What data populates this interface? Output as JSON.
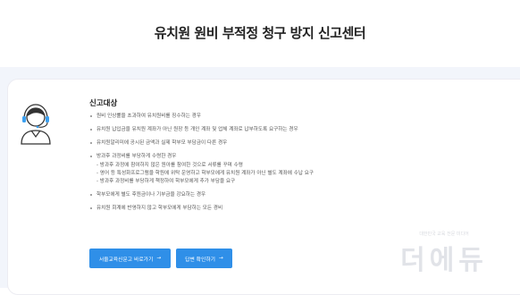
{
  "page": {
    "title": "유치원 원비 부적정 청구 방지 신고센터"
  },
  "report": {
    "section_title": "신고대상",
    "items": [
      "원비 인상률을 초과하여 유치원비를 징수하는 경우",
      "유치원 납입금을 유치원 계좌가 아닌 원장 등 개인 계좌 및 업체 계좌로 납부하도록 요구하는 경우",
      "유치원알리미에 공시된 금액과 실제 학부모 부담금이 다른 경우"
    ],
    "group": {
      "label": "방과후 과정비를 부당하게 수령한 경우",
      "sub_items": [
        "- 방과후 과정에 참여하지 않은 원아를 참여한 것으로 서류를 꾸며 수령",
        "- 영어 등 특성화프로그램을 학원에 위탁 운영하고 학부모에게 유치원 계좌가 아닌 별도 계좌에 수납 요구",
        "- 방과후 과정비를 부당하게 책정하여 학부모에게 추가 부담을 요구"
      ]
    },
    "items_after": [
      "학부모에게 별도 후원금이나 기부금을 강요하는 경우",
      "유치원 회계에 반영하지 않고 학부모에게 부담하는 모든 경비"
    ]
  },
  "buttons": {
    "seoul_report": "서울교육신문고 바로가기",
    "check_answer": "답변 확인하기",
    "arrow": "→"
  },
  "watermark": {
    "small": "대한민국 교육 전문 미디어",
    "big": "더에듀"
  },
  "colors": {
    "accent": "#2f8fe8",
    "band": "#f2f5fb"
  },
  "icons": {
    "avatar": "headset-operator-icon"
  }
}
